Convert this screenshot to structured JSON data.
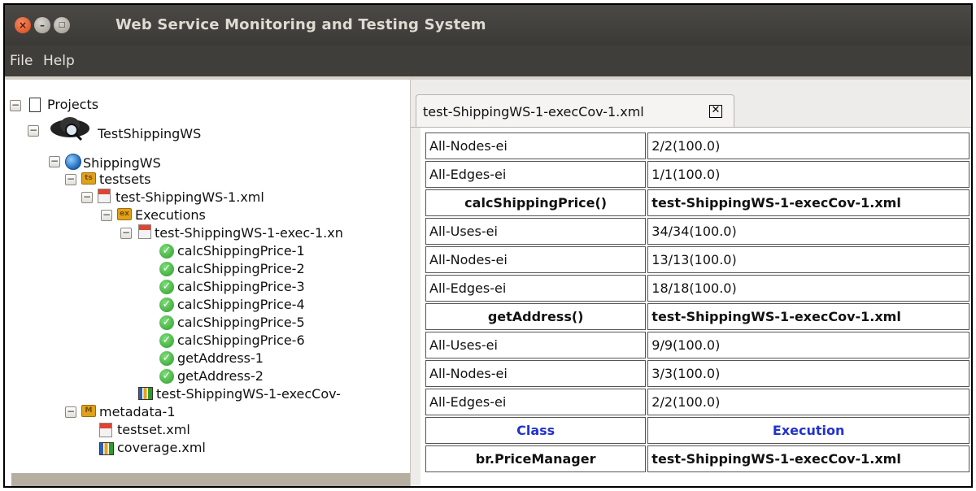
{
  "window": {
    "title": "Web Service Monitoring and Testing System"
  },
  "menu": {
    "items": [
      "File",
      "Help"
    ]
  },
  "tree": {
    "root": "Projects",
    "project": "TestShippingWS",
    "service": "ShippingWS",
    "testsets": "testsets",
    "testset_file": "test-ShippingWS-1.xml",
    "executions": "Executions",
    "exec_file": "test-ShippingWS-1-exec-1.xn",
    "results": [
      "calcShippingPrice-1",
      "calcShippingPrice-2",
      "calcShippingPrice-3",
      "calcShippingPrice-4",
      "calcShippingPrice-5",
      "calcShippingPrice-6",
      "getAddress-1",
      "getAddress-2"
    ],
    "coverage_exec": "test-ShippingWS-1-execCov-",
    "metadata": "metadata-1",
    "testset_xml": "testset.xml",
    "coverage_xml": "coverage.xml"
  },
  "tab": {
    "label": "test-ShippingWS-1-execCov-1.xml",
    "close": "✕"
  },
  "table": {
    "rows": [
      [
        "All-Nodes-ei",
        "2/2(100.0)"
      ],
      [
        "All-Edges-ei",
        "1/1(100.0)"
      ],
      [
        "calcShippingPrice()",
        "test-ShippingWS-1-execCov-1.xml"
      ],
      [
        "All-Uses-ei",
        "34/34(100.0)"
      ],
      [
        "All-Nodes-ei",
        "13/13(100.0)"
      ],
      [
        "All-Edges-ei",
        "18/18(100.0)"
      ],
      [
        "getAddress()",
        "test-ShippingWS-1-execCov-1.xml"
      ],
      [
        "All-Uses-ei",
        "9/9(100.0)"
      ],
      [
        "All-Nodes-ei",
        "3/3(100.0)"
      ],
      [
        "All-Edges-ei",
        "2/2(100.0)"
      ],
      [
        "Class",
        "Execution"
      ],
      [
        "br.PriceManager",
        "test-ShippingWS-1-execCov-1.xml"
      ]
    ]
  }
}
